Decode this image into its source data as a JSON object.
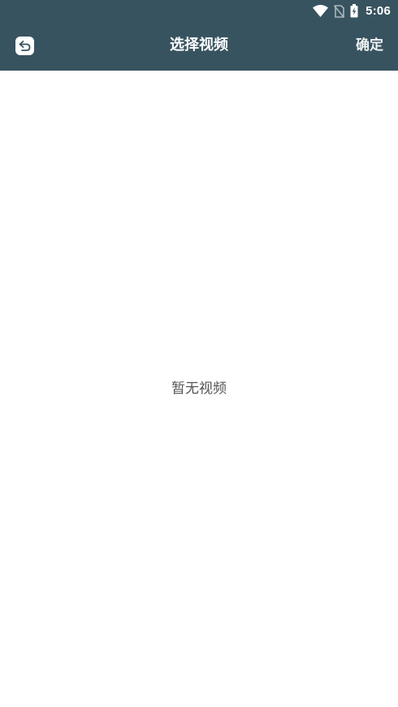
{
  "status_bar": {
    "time": "5:06",
    "icons": [
      "wifi-icon",
      "no-sim-icon",
      "battery-charging-icon"
    ]
  },
  "toolbar": {
    "title": "选择视频",
    "confirm_label": "确定",
    "back_icon": "back-arrow-icon"
  },
  "content": {
    "empty_message": "暂无视频"
  },
  "colors": {
    "header_background": "#37535f",
    "page_background": "#ffffff",
    "empty_text": "#555555"
  }
}
